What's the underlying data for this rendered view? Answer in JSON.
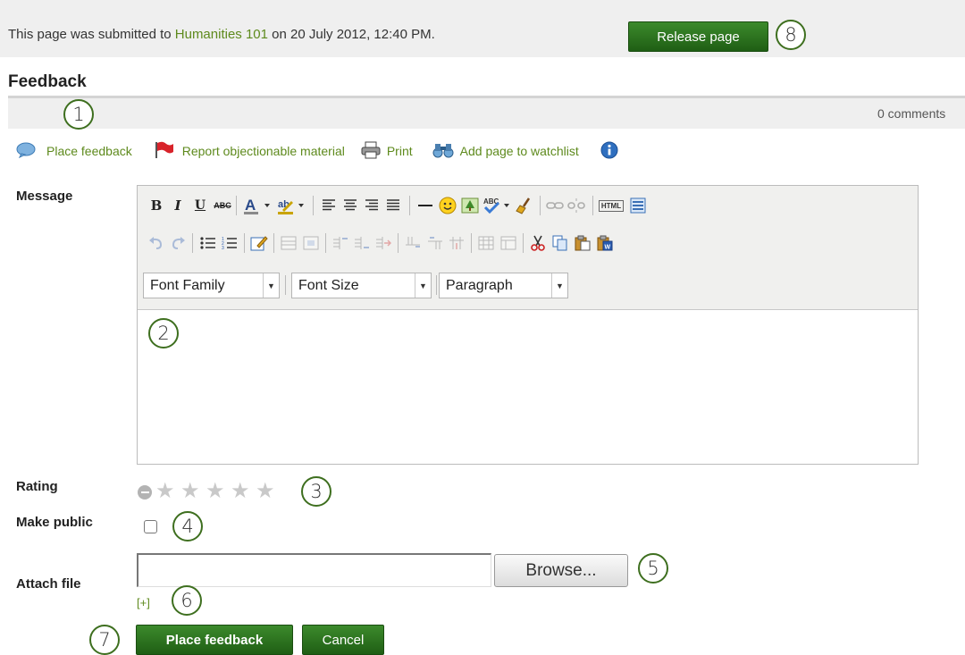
{
  "submission": {
    "text_before": "This page was submitted to",
    "group_link": "Humanities 101",
    "text_after": "on 20 July 2012, 12:40 PM.",
    "release_button": "Release page"
  },
  "feedback": {
    "heading": "Feedback",
    "comments_count": "0 comments"
  },
  "actions": {
    "place_feedback": "Place feedback",
    "report": "Report objectionable material",
    "print": "Print",
    "watchlist": "Add page to watchlist"
  },
  "form": {
    "message_label": "Message",
    "rating_label": "Rating",
    "rating_value": 0,
    "rating_max": 5,
    "make_public_label": "Make public",
    "attach_file_label": "Attach file",
    "browse_button": "Browse...",
    "add_more": "[+]",
    "submit_button": "Place feedback",
    "cancel_button": "Cancel"
  },
  "editor": {
    "font_family": "Font Family",
    "font_size": "Font Size",
    "paragraph": "Paragraph",
    "html_button": "HTML"
  },
  "callouts": [
    "1",
    "2",
    "3",
    "4",
    "5",
    "6",
    "7",
    "8"
  ],
  "colors": {
    "accent_green": "#2c6e1e",
    "link_green": "#5e8a1d",
    "callout_border": "#3e6f1f"
  }
}
